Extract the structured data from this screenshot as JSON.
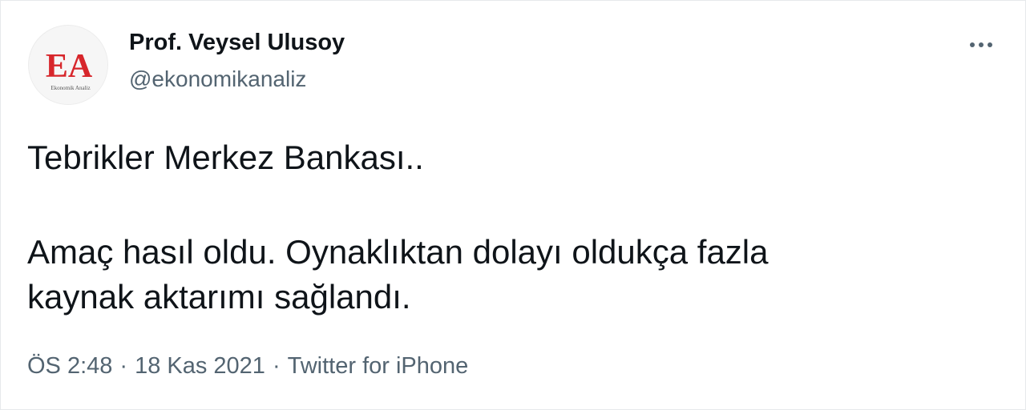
{
  "author": {
    "display_name": "Prof. Veysel Ulusoy",
    "handle": "@ekonomikanaliz",
    "avatar": {
      "logo_letters": "EA",
      "logo_tagline": "Ekonomik Analiz",
      "logo_color": "#d7262b"
    }
  },
  "more_icon": "more-horizontal-icon",
  "tweet": {
    "paragraphs": [
      [
        "Tebrikler Merkez Bankası.."
      ],
      [
        "Amaç hasıl oldu. Oynaklıktan dolayı oldukça fazla",
        "kaynak aktarımı sağlandı."
      ]
    ]
  },
  "meta": {
    "time": "ÖS 2:48",
    "separator": "·",
    "date": "18 Kas 2021",
    "source": "Twitter for iPhone"
  },
  "colors": {
    "text": "#0f1419",
    "secondary": "#536471",
    "border": "#e6e9eb"
  }
}
